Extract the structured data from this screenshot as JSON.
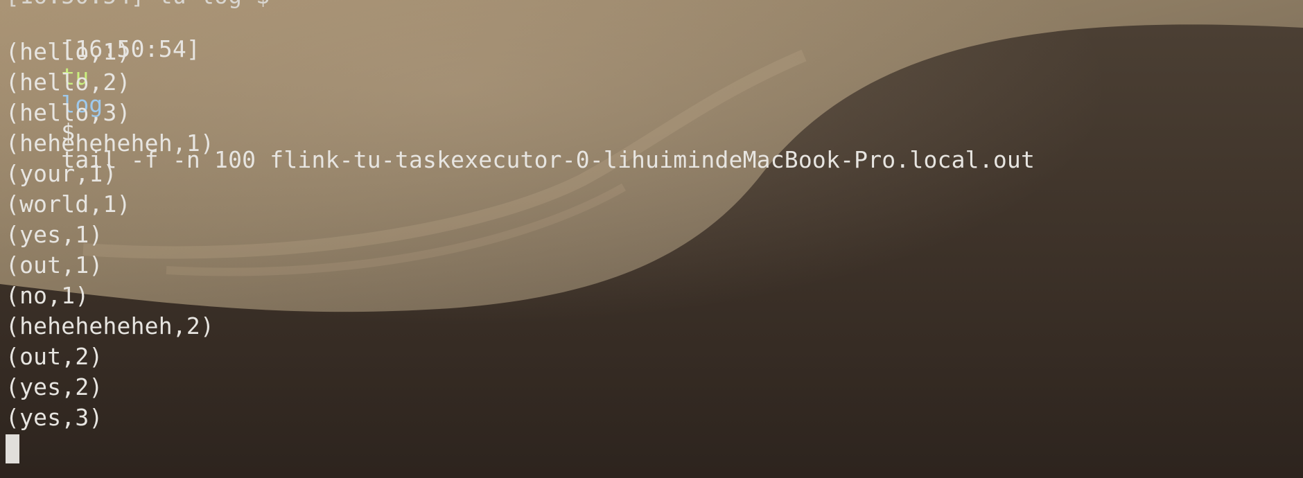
{
  "terminal": {
    "partial_top_line": "[16:50:54] tu log $",
    "prompt": {
      "time": "[16:50:54]",
      "user": "tu",
      "directory": "log",
      "symbol": "$",
      "command": "tail -f -n 100 flink-tu-taskexecutor-0-lihuimindeMacBook-Pro.local.out"
    },
    "output": [
      "(hello,1)",
      "(hello,2)",
      "(hello,3)",
      "(heheheheheh,1)",
      "(your,1)",
      "(world,1)",
      "(yes,1)",
      "(out,1)",
      "(no,1)",
      "(heheheheheh,2)",
      "(out,2)",
      "(yes,2)",
      "(yes,3)"
    ]
  },
  "colors": {
    "text": "#e7e5e1",
    "user": "#c9ef7e",
    "directory": "#9ec9ec"
  }
}
